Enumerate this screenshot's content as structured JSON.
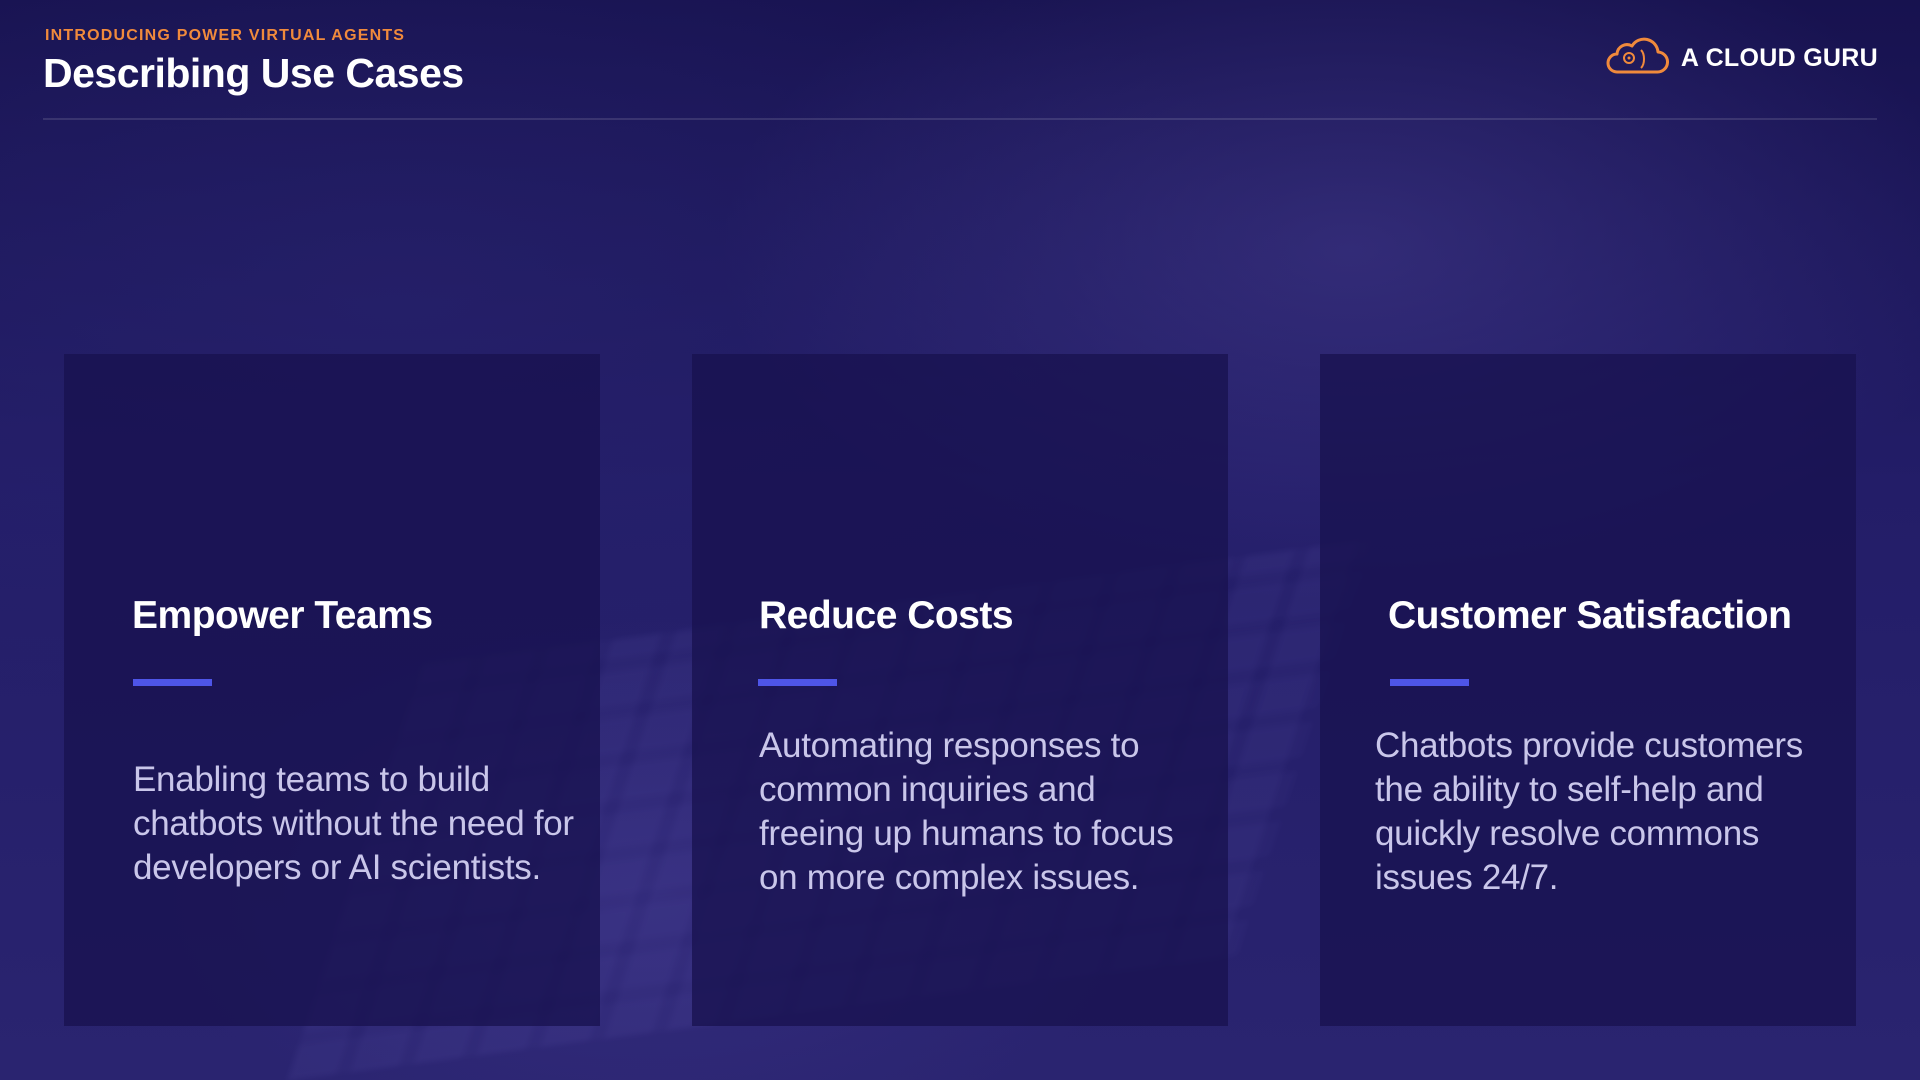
{
  "header": {
    "eyebrow": "INTRODUCING POWER VIRTUAL AGENTS",
    "title": "Describing Use Cases",
    "logo_text": "A CLOUD GURU",
    "logo_icon": "cloud-icon",
    "accent_color": "#f08a3c"
  },
  "cards": [
    {
      "title": "Empower Teams",
      "body": "Enabling teams to build chatbots without the need for developers or AI scientists."
    },
    {
      "title": "Reduce Costs",
      "body": "Automating responses to common inquiries and freeing up humans to focus on more complex issues."
    },
    {
      "title": "Customer Satisfaction",
      "body": "Chatbots provide customers the ability to self-help and quickly resolve commons issues 24/7."
    }
  ],
  "colors": {
    "background": "#1b1656",
    "card_background": "#181250",
    "rule": "#4e55e8",
    "heading": "#ffffff",
    "body_text": "#c9c6ea"
  }
}
